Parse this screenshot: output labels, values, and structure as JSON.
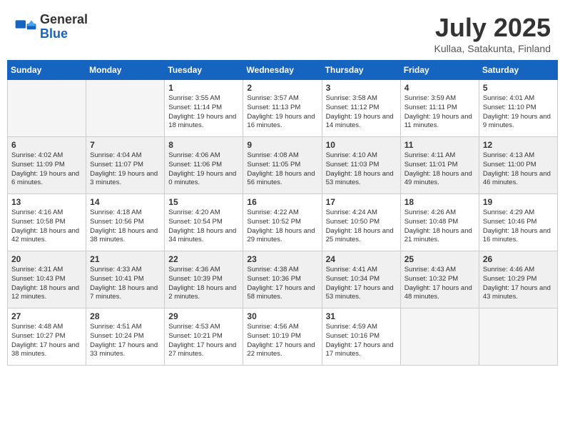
{
  "logo": {
    "general": "General",
    "blue": "Blue"
  },
  "title": "July 2025",
  "location": "Kullaa, Satakunta, Finland",
  "days_of_week": [
    "Sunday",
    "Monday",
    "Tuesday",
    "Wednesday",
    "Thursday",
    "Friday",
    "Saturday"
  ],
  "weeks": [
    [
      {
        "day": "",
        "info": ""
      },
      {
        "day": "",
        "info": ""
      },
      {
        "day": "1",
        "info": "Sunrise: 3:55 AM\nSunset: 11:14 PM\nDaylight: 19 hours and 18 minutes."
      },
      {
        "day": "2",
        "info": "Sunrise: 3:57 AM\nSunset: 11:13 PM\nDaylight: 19 hours and 16 minutes."
      },
      {
        "day": "3",
        "info": "Sunrise: 3:58 AM\nSunset: 11:12 PM\nDaylight: 19 hours and 14 minutes."
      },
      {
        "day": "4",
        "info": "Sunrise: 3:59 AM\nSunset: 11:11 PM\nDaylight: 19 hours and 11 minutes."
      },
      {
        "day": "5",
        "info": "Sunrise: 4:01 AM\nSunset: 11:10 PM\nDaylight: 19 hours and 9 minutes."
      }
    ],
    [
      {
        "day": "6",
        "info": "Sunrise: 4:02 AM\nSunset: 11:09 PM\nDaylight: 19 hours and 6 minutes."
      },
      {
        "day": "7",
        "info": "Sunrise: 4:04 AM\nSunset: 11:07 PM\nDaylight: 19 hours and 3 minutes."
      },
      {
        "day": "8",
        "info": "Sunrise: 4:06 AM\nSunset: 11:06 PM\nDaylight: 19 hours and 0 minutes."
      },
      {
        "day": "9",
        "info": "Sunrise: 4:08 AM\nSunset: 11:05 PM\nDaylight: 18 hours and 56 minutes."
      },
      {
        "day": "10",
        "info": "Sunrise: 4:10 AM\nSunset: 11:03 PM\nDaylight: 18 hours and 53 minutes."
      },
      {
        "day": "11",
        "info": "Sunrise: 4:11 AM\nSunset: 11:01 PM\nDaylight: 18 hours and 49 minutes."
      },
      {
        "day": "12",
        "info": "Sunrise: 4:13 AM\nSunset: 11:00 PM\nDaylight: 18 hours and 46 minutes."
      }
    ],
    [
      {
        "day": "13",
        "info": "Sunrise: 4:16 AM\nSunset: 10:58 PM\nDaylight: 18 hours and 42 minutes."
      },
      {
        "day": "14",
        "info": "Sunrise: 4:18 AM\nSunset: 10:56 PM\nDaylight: 18 hours and 38 minutes."
      },
      {
        "day": "15",
        "info": "Sunrise: 4:20 AM\nSunset: 10:54 PM\nDaylight: 18 hours and 34 minutes."
      },
      {
        "day": "16",
        "info": "Sunrise: 4:22 AM\nSunset: 10:52 PM\nDaylight: 18 hours and 29 minutes."
      },
      {
        "day": "17",
        "info": "Sunrise: 4:24 AM\nSunset: 10:50 PM\nDaylight: 18 hours and 25 minutes."
      },
      {
        "day": "18",
        "info": "Sunrise: 4:26 AM\nSunset: 10:48 PM\nDaylight: 18 hours and 21 minutes."
      },
      {
        "day": "19",
        "info": "Sunrise: 4:29 AM\nSunset: 10:46 PM\nDaylight: 18 hours and 16 minutes."
      }
    ],
    [
      {
        "day": "20",
        "info": "Sunrise: 4:31 AM\nSunset: 10:43 PM\nDaylight: 18 hours and 12 minutes."
      },
      {
        "day": "21",
        "info": "Sunrise: 4:33 AM\nSunset: 10:41 PM\nDaylight: 18 hours and 7 minutes."
      },
      {
        "day": "22",
        "info": "Sunrise: 4:36 AM\nSunset: 10:39 PM\nDaylight: 18 hours and 2 minutes."
      },
      {
        "day": "23",
        "info": "Sunrise: 4:38 AM\nSunset: 10:36 PM\nDaylight: 17 hours and 58 minutes."
      },
      {
        "day": "24",
        "info": "Sunrise: 4:41 AM\nSunset: 10:34 PM\nDaylight: 17 hours and 53 minutes."
      },
      {
        "day": "25",
        "info": "Sunrise: 4:43 AM\nSunset: 10:32 PM\nDaylight: 17 hours and 48 minutes."
      },
      {
        "day": "26",
        "info": "Sunrise: 4:46 AM\nSunset: 10:29 PM\nDaylight: 17 hours and 43 minutes."
      }
    ],
    [
      {
        "day": "27",
        "info": "Sunrise: 4:48 AM\nSunset: 10:27 PM\nDaylight: 17 hours and 38 minutes."
      },
      {
        "day": "28",
        "info": "Sunrise: 4:51 AM\nSunset: 10:24 PM\nDaylight: 17 hours and 33 minutes."
      },
      {
        "day": "29",
        "info": "Sunrise: 4:53 AM\nSunset: 10:21 PM\nDaylight: 17 hours and 27 minutes."
      },
      {
        "day": "30",
        "info": "Sunrise: 4:56 AM\nSunset: 10:19 PM\nDaylight: 17 hours and 22 minutes."
      },
      {
        "day": "31",
        "info": "Sunrise: 4:59 AM\nSunset: 10:16 PM\nDaylight: 17 hours and 17 minutes."
      },
      {
        "day": "",
        "info": ""
      },
      {
        "day": "",
        "info": ""
      }
    ]
  ]
}
